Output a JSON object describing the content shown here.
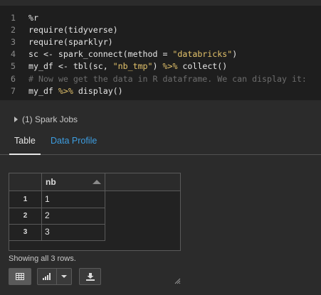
{
  "code_cell": {
    "lines": [
      {
        "num": "1",
        "parts": [
          {
            "t": "%r",
            "c": "tok-magic"
          }
        ]
      },
      {
        "num": "2",
        "parts": [
          {
            "t": "require(tidyverse)",
            "c": ""
          }
        ]
      },
      {
        "num": "3",
        "parts": [
          {
            "t": "require(sparklyr)",
            "c": ""
          }
        ]
      },
      {
        "num": "4",
        "parts": [
          {
            "t": "sc <- spark_connect(method = ",
            "c": ""
          },
          {
            "t": "\"databricks\"",
            "c": "tok-str"
          },
          {
            "t": ")",
            "c": ""
          }
        ]
      },
      {
        "num": "5",
        "parts": [
          {
            "t": "my_df <- tbl(sc, ",
            "c": ""
          },
          {
            "t": "\"nb_tmp\"",
            "c": "tok-str"
          },
          {
            "t": ") ",
            "c": ""
          },
          {
            "t": "%>%",
            "c": "tok-pipe"
          },
          {
            "t": " collect()",
            "c": ""
          }
        ]
      },
      {
        "num": "6",
        "parts": [
          {
            "t": "# Now we get the data in R dataframe. We can display it:",
            "c": "tok-comment"
          }
        ]
      },
      {
        "num": "7",
        "parts": [
          {
            "t": "my_df ",
            "c": ""
          },
          {
            "t": "%>%",
            "c": "tok-pipe"
          },
          {
            "t": " display()",
            "c": ""
          }
        ]
      }
    ]
  },
  "spark_jobs": {
    "label": "(1) Spark Jobs"
  },
  "tabs": {
    "table_label": "Table",
    "profile_label": "Data Profile",
    "active": "Table"
  },
  "results": {
    "column": "nb",
    "rows": [
      {
        "index": "1",
        "nb": "1"
      },
      {
        "index": "2",
        "nb": "2"
      },
      {
        "index": "3",
        "nb": "3"
      }
    ],
    "summary": "Showing all 3 rows."
  },
  "toolbar": {
    "icons": [
      "table-icon",
      "bar-chart-icon",
      "chevron-down-icon",
      "download-icon"
    ]
  },
  "colors": {
    "accent": "#3d9de0",
    "string": "#e4c36b",
    "comment": "#6d6d6d",
    "background": "#2b2b2b",
    "code_bg": "#1e1e1e"
  }
}
